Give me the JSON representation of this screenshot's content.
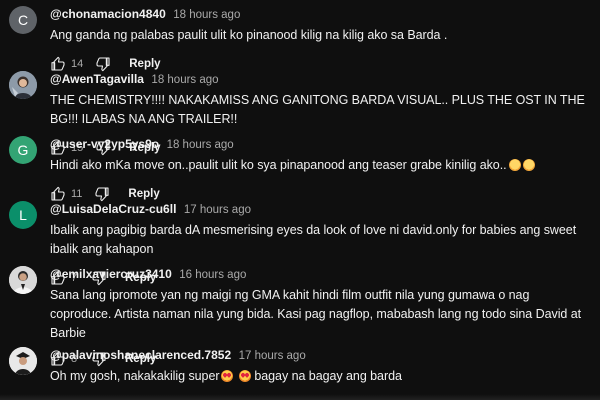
{
  "comments": [
    {
      "author": "@chonamacion4840",
      "time": "18 hours ago",
      "avatar_letter": "C",
      "avatar_color": "#5f6368",
      "text": "Ang ganda ng palabas paulit ulit ko pinanood kilig na kilig ako sa Barda .",
      "likes": "14",
      "reply_label": "Reply"
    },
    {
      "author": "@AwenTagavilla",
      "time": "18 hours ago",
      "avatar_letter": "",
      "avatar_color": "#7b8a99",
      "text": "THE CHEMISTRY!!!! NAKAKAMISS ANG GANITONG BARDA VISUAL.. PLUS THE OST IN THE BG!!! ILABAS NA ANG TRAILER!!",
      "likes": "15",
      "reply_label": "Reply"
    },
    {
      "author": "@user-vy2yp5ys9o",
      "time": "18 hours ago",
      "avatar_letter": "G",
      "avatar_color": "#33a474",
      "text": "Hindi ako mKa move on..paulit ulit ko sya pinapanood ang teaser grabe kinilig ako..",
      "likes": "11",
      "reply_label": "Reply"
    },
    {
      "author": "@LuisaDelaCruz-cu6ll",
      "time": "17 hours ago",
      "avatar_letter": "L",
      "avatar_color": "#0b8f6a",
      "text": "Ibalik ang pagibig barda dA mesmerising eyes da look of love ni david.only for babies ang sweet ibalik ang kahapon",
      "likes": "7",
      "reply_label": "Reply"
    },
    {
      "author": "@emilxaviercruz3410",
      "time": "16 hours ago",
      "avatar_letter": "",
      "avatar_color": "#d9d9d9",
      "text": "Sana lang ipromote yan ng maigi ng GMA kahit hindi film outfit nila yung gumawa o nag coproduce. Artista naman nila yung bida. Kasi pag nagflop, mababash lang ng todo sina David at Barbie",
      "likes": "8",
      "reply_label": "Reply"
    },
    {
      "author": "@palavinoshaneclarenced.7852",
      "time": "17 hours ago",
      "avatar_letter": "",
      "avatar_color": "#e8e8e8",
      "text": "Oh my gosh, nakakakilig super",
      "text_after": "bagay na bagay ang barda",
      "likes": "",
      "reply_label": ""
    }
  ]
}
